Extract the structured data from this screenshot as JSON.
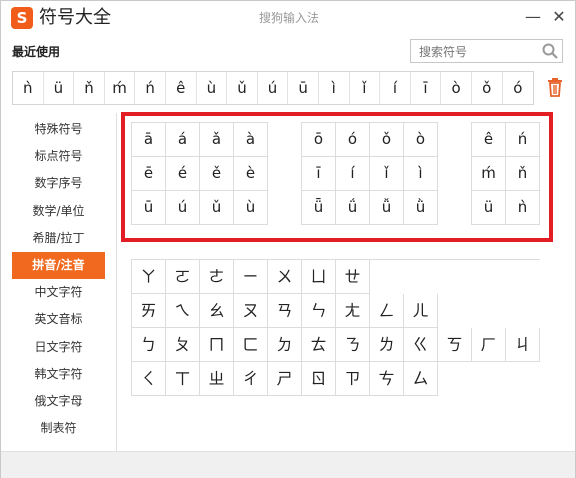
{
  "app": {
    "logo_glyph": "S",
    "title": "符号大全",
    "window_title": "搜狗输入法",
    "minimize": "—",
    "close": "✕"
  },
  "recent": {
    "label": "最近使用",
    "items": [
      "ǹ",
      "ü",
      "ň",
      "ḿ",
      "ń",
      "ê",
      "ù",
      "ǔ",
      "ú",
      "ū",
      "ì",
      "ǐ",
      "í",
      "ī",
      "ò",
      "ǒ",
      "ó"
    ],
    "clear_icon": "trash-icon"
  },
  "search": {
    "placeholder": "搜索符号",
    "icon": "search-icon"
  },
  "sidebar": {
    "items": [
      "特殊符号",
      "标点符号",
      "数字序号",
      "数学/单位",
      "希腊/拉丁",
      "拼音/注音",
      "中文字符",
      "英文音标",
      "日文字符",
      "韩文字符",
      "俄文字母",
      "制表符"
    ],
    "active_index": 5
  },
  "pinyin": {
    "group_a": [
      "ā",
      "á",
      "ǎ",
      "à",
      "ē",
      "é",
      "ě",
      "è",
      "ū",
      "ú",
      "ǔ",
      "ù"
    ],
    "group_o": [
      "ō",
      "ó",
      "ǒ",
      "ò",
      "ī",
      "í",
      "ǐ",
      "ì",
      "ǖ",
      "ǘ",
      "ǚ",
      "ǜ"
    ],
    "group_e": [
      "ê",
      "ń",
      "ḿ",
      "ň",
      "ü",
      "ǹ"
    ]
  },
  "zhuyin": {
    "rows": [
      [
        "ㄚ",
        "ㄛ",
        "ㄜ",
        "ㄧ",
        "ㄨ",
        "ㄩ",
        "ㄝ"
      ],
      [
        "ㄞ",
        "ㄟ",
        "ㄠ",
        "ㄡ",
        "ㄢ",
        "ㄣ",
        "ㄤ",
        "ㄥ",
        "ㄦ"
      ],
      [
        "ㄅ",
        "ㄆ",
        "ㄇ",
        "ㄈ",
        "ㄉ",
        "ㄊ",
        "ㄋ",
        "ㄌ",
        "ㄍ",
        "ㄎ",
        "ㄏ",
        "ㄐ"
      ],
      [
        "ㄑ",
        "ㄒ",
        "ㄓ",
        "ㄔ",
        "ㄕ",
        "ㄖ",
        "ㄗ",
        "ㄘ",
        "ㄙ"
      ]
    ]
  },
  "colors": {
    "accent": "#f0691f",
    "highlight_box": "#e21e24"
  }
}
